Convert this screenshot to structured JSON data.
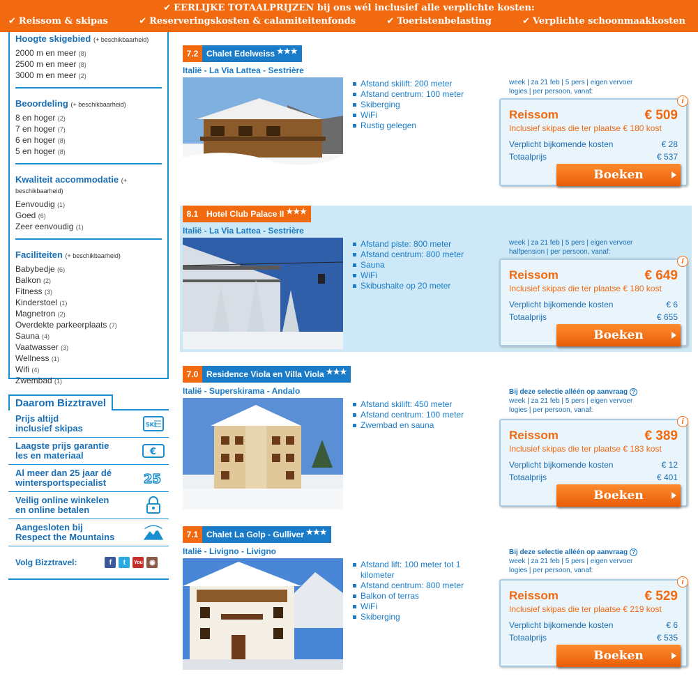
{
  "banner": {
    "headline": "EERLIJKE TOTAALPRIJZEN bij ons wél inclusief alle verplichte kosten:",
    "items": [
      "Reissom & skipas",
      "Reserveringskosten & calamiteitenfonds",
      "Toeristenbelasting",
      "Verplichte schoonmaakkosten"
    ]
  },
  "filters": [
    {
      "title": "Hoogte skigebied",
      "note": "(+ beschikbaarheid)",
      "items": [
        {
          "label": "2000 m en meer",
          "count": "(8)"
        },
        {
          "label": "2500 m en meer",
          "count": "(8)"
        },
        {
          "label": "3000 m en meer",
          "count": "(2)"
        }
      ]
    },
    {
      "title": "Beoordeling",
      "note": "(+ beschikbaarheid)",
      "items": [
        {
          "label": "8 en hoger",
          "count": "(2)"
        },
        {
          "label": "7 en hoger",
          "count": "(7)"
        },
        {
          "label": "6 en hoger",
          "count": "(8)"
        },
        {
          "label": "5 en hoger",
          "count": "(8)"
        }
      ]
    },
    {
      "title": "Kwaliteit accommodatie",
      "note": "(+ beschikbaarheid)",
      "items": [
        {
          "label": "Eenvoudig",
          "count": "(1)"
        },
        {
          "label": "Goed",
          "count": "(6)"
        },
        {
          "label": "Zeer eenvoudig",
          "count": "(1)"
        }
      ]
    },
    {
      "title": "Faciliteiten",
      "note": "(+ beschikbaarheid)",
      "items": [
        {
          "label": "Babybedje",
          "count": "(6)"
        },
        {
          "label": "Balkon",
          "count": "(2)"
        },
        {
          "label": "Fitness",
          "count": "(3)"
        },
        {
          "label": "Kinderstoel",
          "count": "(1)"
        },
        {
          "label": "Magnetron",
          "count": "(2)"
        },
        {
          "label": "Overdekte parkeerplaats",
          "count": "(7)"
        },
        {
          "label": "Sauna",
          "count": "(4)"
        },
        {
          "label": "Vaatwasser",
          "count": "(3)"
        },
        {
          "label": "Wellness",
          "count": "(1)"
        },
        {
          "label": "Wifi",
          "count": "(4)"
        },
        {
          "label": "Zwembad",
          "count": "(1)"
        }
      ]
    }
  ],
  "why": {
    "title": "Daarom Bizztravel",
    "items": [
      {
        "line1": "Prijs altijd",
        "line2": "inclusief skipas",
        "icon": "skipass-icon"
      },
      {
        "line1": "Laagste prijs garantie",
        "line2": "les en materiaal",
        "icon": "euro-ticket-icon"
      },
      {
        "line1": "Al meer dan 25 jaar dé",
        "line2": "wintersportspecialist",
        "icon": "25-years-icon"
      },
      {
        "line1": "Veilig online winkelen",
        "line2": "en online betalen",
        "icon": "lock-icon"
      },
      {
        "line1": "Aangesloten bij",
        "line2": "Respect the Mountains",
        "icon": "respect-mountains-icon"
      }
    ],
    "follow": "Volg Bizztravel:"
  },
  "listings": [
    {
      "score": "7.2",
      "name": "Chalet Edelweiss",
      "stars": "★★★",
      "location": "Italië - La Via Lattea - Sestrière",
      "features": [
        "Afstand skilift: 200 meter",
        "Afstand centrum: 100 meter",
        "Skiberging",
        "WiFi",
        "Rustig gelegen"
      ],
      "onrequest": "",
      "meta1": "week | za 21 feb | 5 pers | eigen vervoer",
      "meta2": "logies | per persoon, vanaf:",
      "price_label": "Reissom",
      "price": "€ 509",
      "skipas": "Inclusief skipas die ter plaatse € 180 kost",
      "extra_label": "Verplicht bijkomende kosten",
      "extra": "€ 28",
      "total_label": "Totaalprijs",
      "total": "€ 537",
      "book": "Boeken"
    },
    {
      "score": "8.1",
      "name": "Hotel Club Palace II",
      "stars": "★★★",
      "location": "Italië - La Via Lattea - Sestrière",
      "features": [
        "Afstand piste: 800 meter",
        "Afstand centrum: 800 meter",
        "Sauna",
        "WiFi",
        "Skibushalte op 20 meter"
      ],
      "onrequest": "",
      "meta1": "week | za 21 feb | 5 pers | eigen vervoer",
      "meta2": "halfpension | per persoon, vanaf:",
      "price_label": "Reissom",
      "price": "€ 649",
      "skipas": "Inclusief skipas die ter plaatse € 180 kost",
      "extra_label": "Verplicht bijkomende kosten",
      "extra": "€ 6",
      "total_label": "Totaalprijs",
      "total": "€ 655",
      "book": "Boeken"
    },
    {
      "score": "7.0",
      "name": "Residence Viola en Villa Viola",
      "stars": "★★★",
      "location": "Italië - Superskirama - Andalo",
      "features": [
        "Afstand skilift: 450 meter",
        "Afstand centrum: 100 meter",
        "Zwembad en sauna"
      ],
      "onrequest": "Bij deze selectie alléén op aanvraag",
      "meta1": "week | za 21 feb | 5 pers | eigen vervoer",
      "meta2": "logies | per persoon, vanaf:",
      "price_label": "Reissom",
      "price": "€ 389",
      "skipas": "Inclusief skipas die ter plaatse € 183 kost",
      "extra_label": "Verplicht bijkomende kosten",
      "extra": "€ 12",
      "total_label": "Totaalprijs",
      "total": "€ 401",
      "book": "Boeken"
    },
    {
      "score": "7.1",
      "name": "Chalet La Golp - Gulliver",
      "stars": "★★★",
      "location": "Italië - Livigno - Livigno",
      "features": [
        "Afstand lift: 100 meter tot 1 kilometer",
        "Afstand centrum: 800 meter",
        "Balkon of terras",
        "WiFi",
        "Skiberging"
      ],
      "onrequest": "Bij deze selectie alléén op aanvraag",
      "meta1": "week | za 21 feb | 5 pers | eigen vervoer",
      "meta2": "logies | per persoon, vanaf:",
      "price_label": "Reissom",
      "price": "€ 529",
      "skipas": "Inclusief skipas die ter plaatse € 219 kost",
      "extra_label": "Verplicht bijkomende kosten",
      "extra": "€ 6",
      "total_label": "Totaalprijs",
      "total": "€ 535",
      "book": "Boeken"
    }
  ],
  "colors": {
    "orange": "#f26a10",
    "blue": "#1a7cc8",
    "alt_bg": "#cde8f6"
  }
}
